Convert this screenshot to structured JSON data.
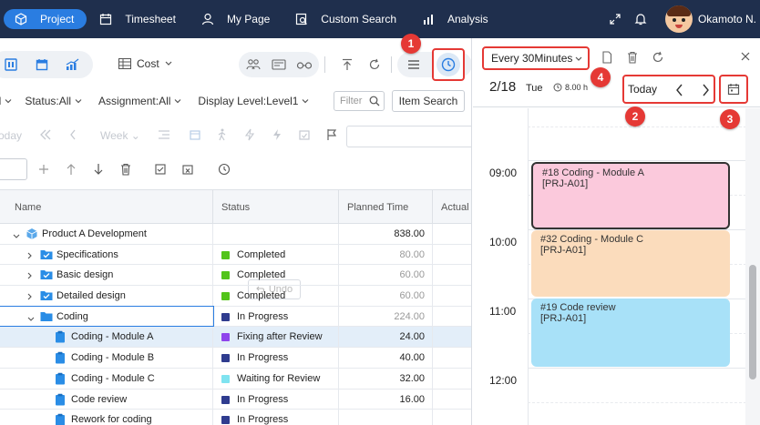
{
  "nav": {
    "items": [
      {
        "label": "Project",
        "icon": "cube-icon",
        "active": true
      },
      {
        "label": "Timesheet",
        "icon": "calendar-icon"
      },
      {
        "label": "My Page",
        "icon": "user-icon"
      },
      {
        "label": "Custom Search",
        "icon": "search-doc-icon"
      },
      {
        "label": "Analysis",
        "icon": "bar-chart-icon"
      }
    ],
    "user_name": "Okamoto N."
  },
  "toolbar": {
    "view_mode": "Cost"
  },
  "filters": {
    "status": "Status:All",
    "assignment": "Assignment:All",
    "display_level": "Display Level:Level1",
    "filter_placeholder": "Filter",
    "item_search": "Item Search"
  },
  "toolbar2": {
    "today": "oday",
    "week": "Week"
  },
  "toolbar3": {
    "undo": "Undo"
  },
  "table": {
    "headers": {
      "name": "Name",
      "status": "Status",
      "planned": "Planned Time",
      "actual": "Actual"
    },
    "rows": [
      {
        "name": "Product A Development",
        "status": "",
        "planned": "838.00"
      },
      {
        "name": "Specifications",
        "status": "Completed",
        "planned": "80.00"
      },
      {
        "name": "Basic design",
        "status": "Completed",
        "planned": "60.00"
      },
      {
        "name": "Detailed design",
        "status": "Completed",
        "planned": "60.00"
      },
      {
        "name": "Coding",
        "status": "In Progress",
        "planned": "224.00"
      },
      {
        "name": "Coding - Module A",
        "status": "Fixing after Review",
        "planned": "24.00"
      },
      {
        "name": "Coding - Module B",
        "status": "In Progress",
        "planned": "40.00"
      },
      {
        "name": "Coding - Module C",
        "status": "Waiting for Review",
        "planned": "32.00"
      },
      {
        "name": "Code review",
        "status": "In Progress",
        "planned": "16.00"
      },
      {
        "name": "Rework for coding",
        "status": "In Progress",
        "planned": ""
      }
    ],
    "status_colors": {
      "Completed": "#52c41a",
      "In Progress": "#2f3c8f",
      "Fixing after Review": "#8e44ec",
      "Waiting for Review": "#7fe3f0"
    }
  },
  "calendar": {
    "interval": "Every 30Minutes",
    "date": "2/18",
    "day": "Tue",
    "hours": "8.00 h",
    "today": "Today",
    "times": [
      "09:00",
      "10:00",
      "11:00",
      "12:00"
    ],
    "events": [
      {
        "title": "#18 Coding - Module A",
        "code": "[PRJ-A01]",
        "color": "#fbc9dc"
      },
      {
        "title": "#32 Coding - Module C",
        "code": "[PRJ-A01]",
        "color": "#fbdcbc"
      },
      {
        "title": "#19 Code review",
        "code": "[PRJ-A01]",
        "color": "#a8e1f8"
      }
    ]
  },
  "callouts": [
    "1",
    "2",
    "3",
    "4"
  ]
}
